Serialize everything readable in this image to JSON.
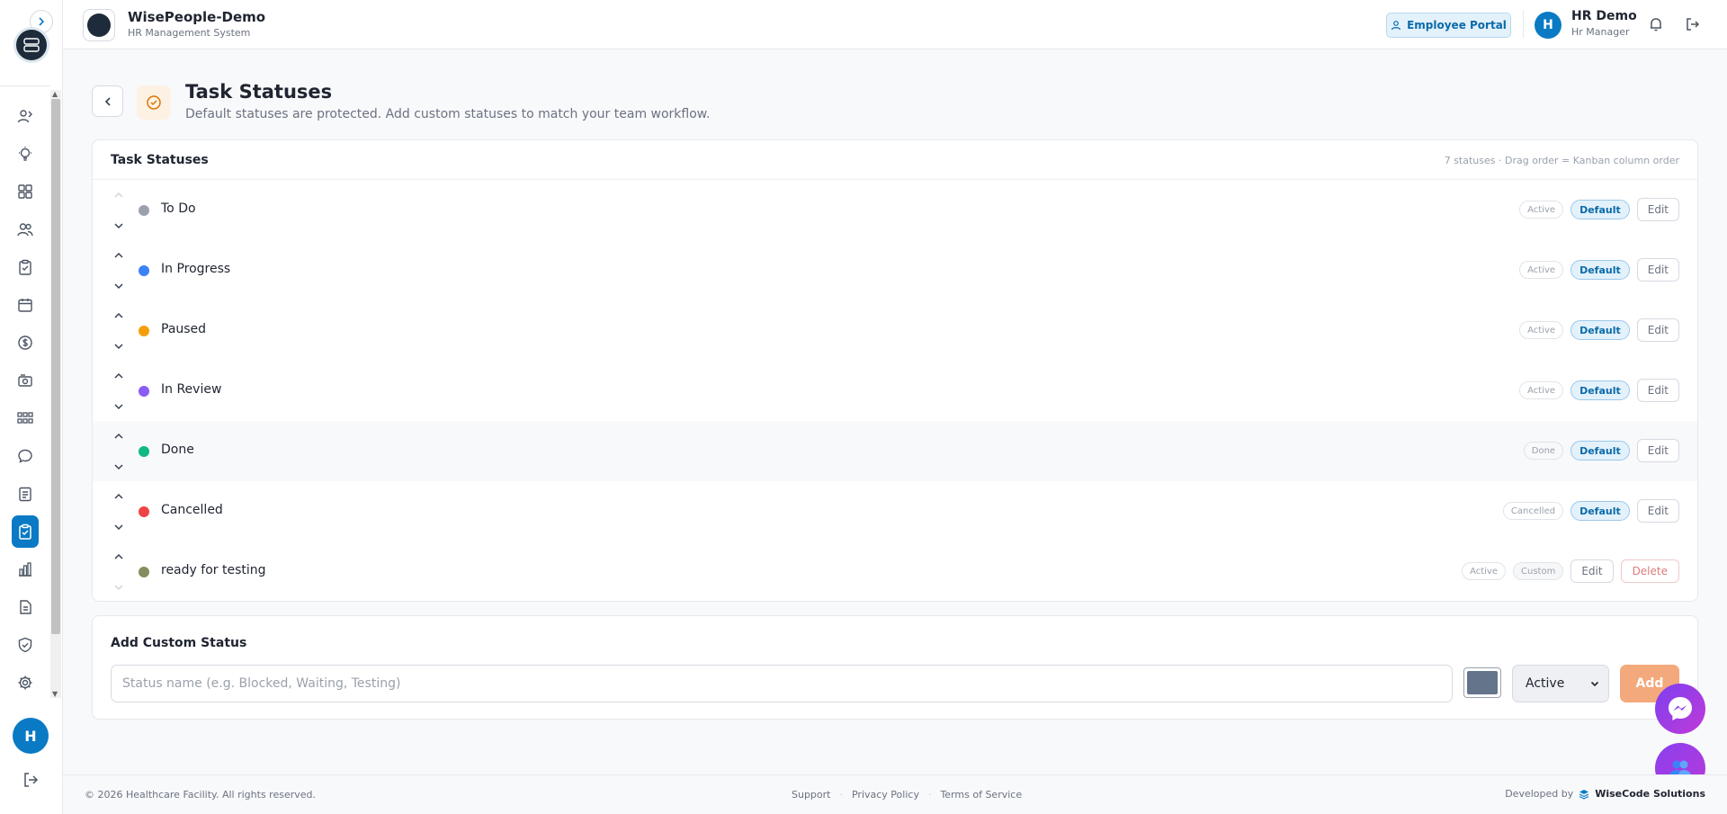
{
  "app": {
    "name": "WisePeople-Demo",
    "subtitle": "HR Management System"
  },
  "header": {
    "portal_button": "Employee Portal",
    "user_initial": "H",
    "user_name": "HR Demo",
    "user_role": "Hr Manager"
  },
  "sidebar": {
    "user_initial": "H",
    "icons": [
      "users-icon",
      "lightbulb-icon",
      "dashboard-icon",
      "team-icon",
      "clipboard-icon",
      "calendar-icon",
      "dollar-icon",
      "camera-icon",
      "org-chart-icon",
      "chat-icon",
      "checklist-icon",
      "task-icon",
      "analytics-icon",
      "document-icon",
      "shield-icon",
      "gear-icon"
    ]
  },
  "page": {
    "title": "Task Statuses",
    "subtitle": "Default statuses are protected. Add custom statuses to match your team workflow."
  },
  "card": {
    "title": "Task Statuses",
    "meta": "7 statuses · Drag order = Kanban column order"
  },
  "labels": {
    "default": "Default",
    "custom": "Custom",
    "edit": "Edit",
    "delete": "Delete"
  },
  "statuses": [
    {
      "name": "To Do",
      "color": "#9aa1ac",
      "category": "Active",
      "type": "Default"
    },
    {
      "name": "In Progress",
      "color": "#3b82f6",
      "category": "Active",
      "type": "Default"
    },
    {
      "name": "Paused",
      "color": "#f59e0b",
      "category": "Active",
      "type": "Default"
    },
    {
      "name": "In Review",
      "color": "#8b5cf6",
      "category": "Active",
      "type": "Default"
    },
    {
      "name": "Done",
      "color": "#10b981",
      "category": "Done",
      "type": "Default"
    },
    {
      "name": "Cancelled",
      "color": "#ef4444",
      "category": "Cancelled",
      "type": "Default"
    },
    {
      "name": "ready for testing",
      "color": "#858d5f",
      "category": "Active",
      "type": "Custom"
    }
  ],
  "add_form": {
    "title": "Add Custom Status",
    "placeholder": "Status name (e.g. Blocked, Waiting, Testing)",
    "color": "#64748b",
    "selected_category": "Active",
    "add_button": "Add"
  },
  "footer": {
    "copyright": "© 2026 Healthcare Facility. All rights reserved.",
    "links": [
      "Support",
      "Privacy Policy",
      "Terms of Service"
    ],
    "developed_by": "Developed by",
    "brand": "WiseCode Solutions"
  }
}
